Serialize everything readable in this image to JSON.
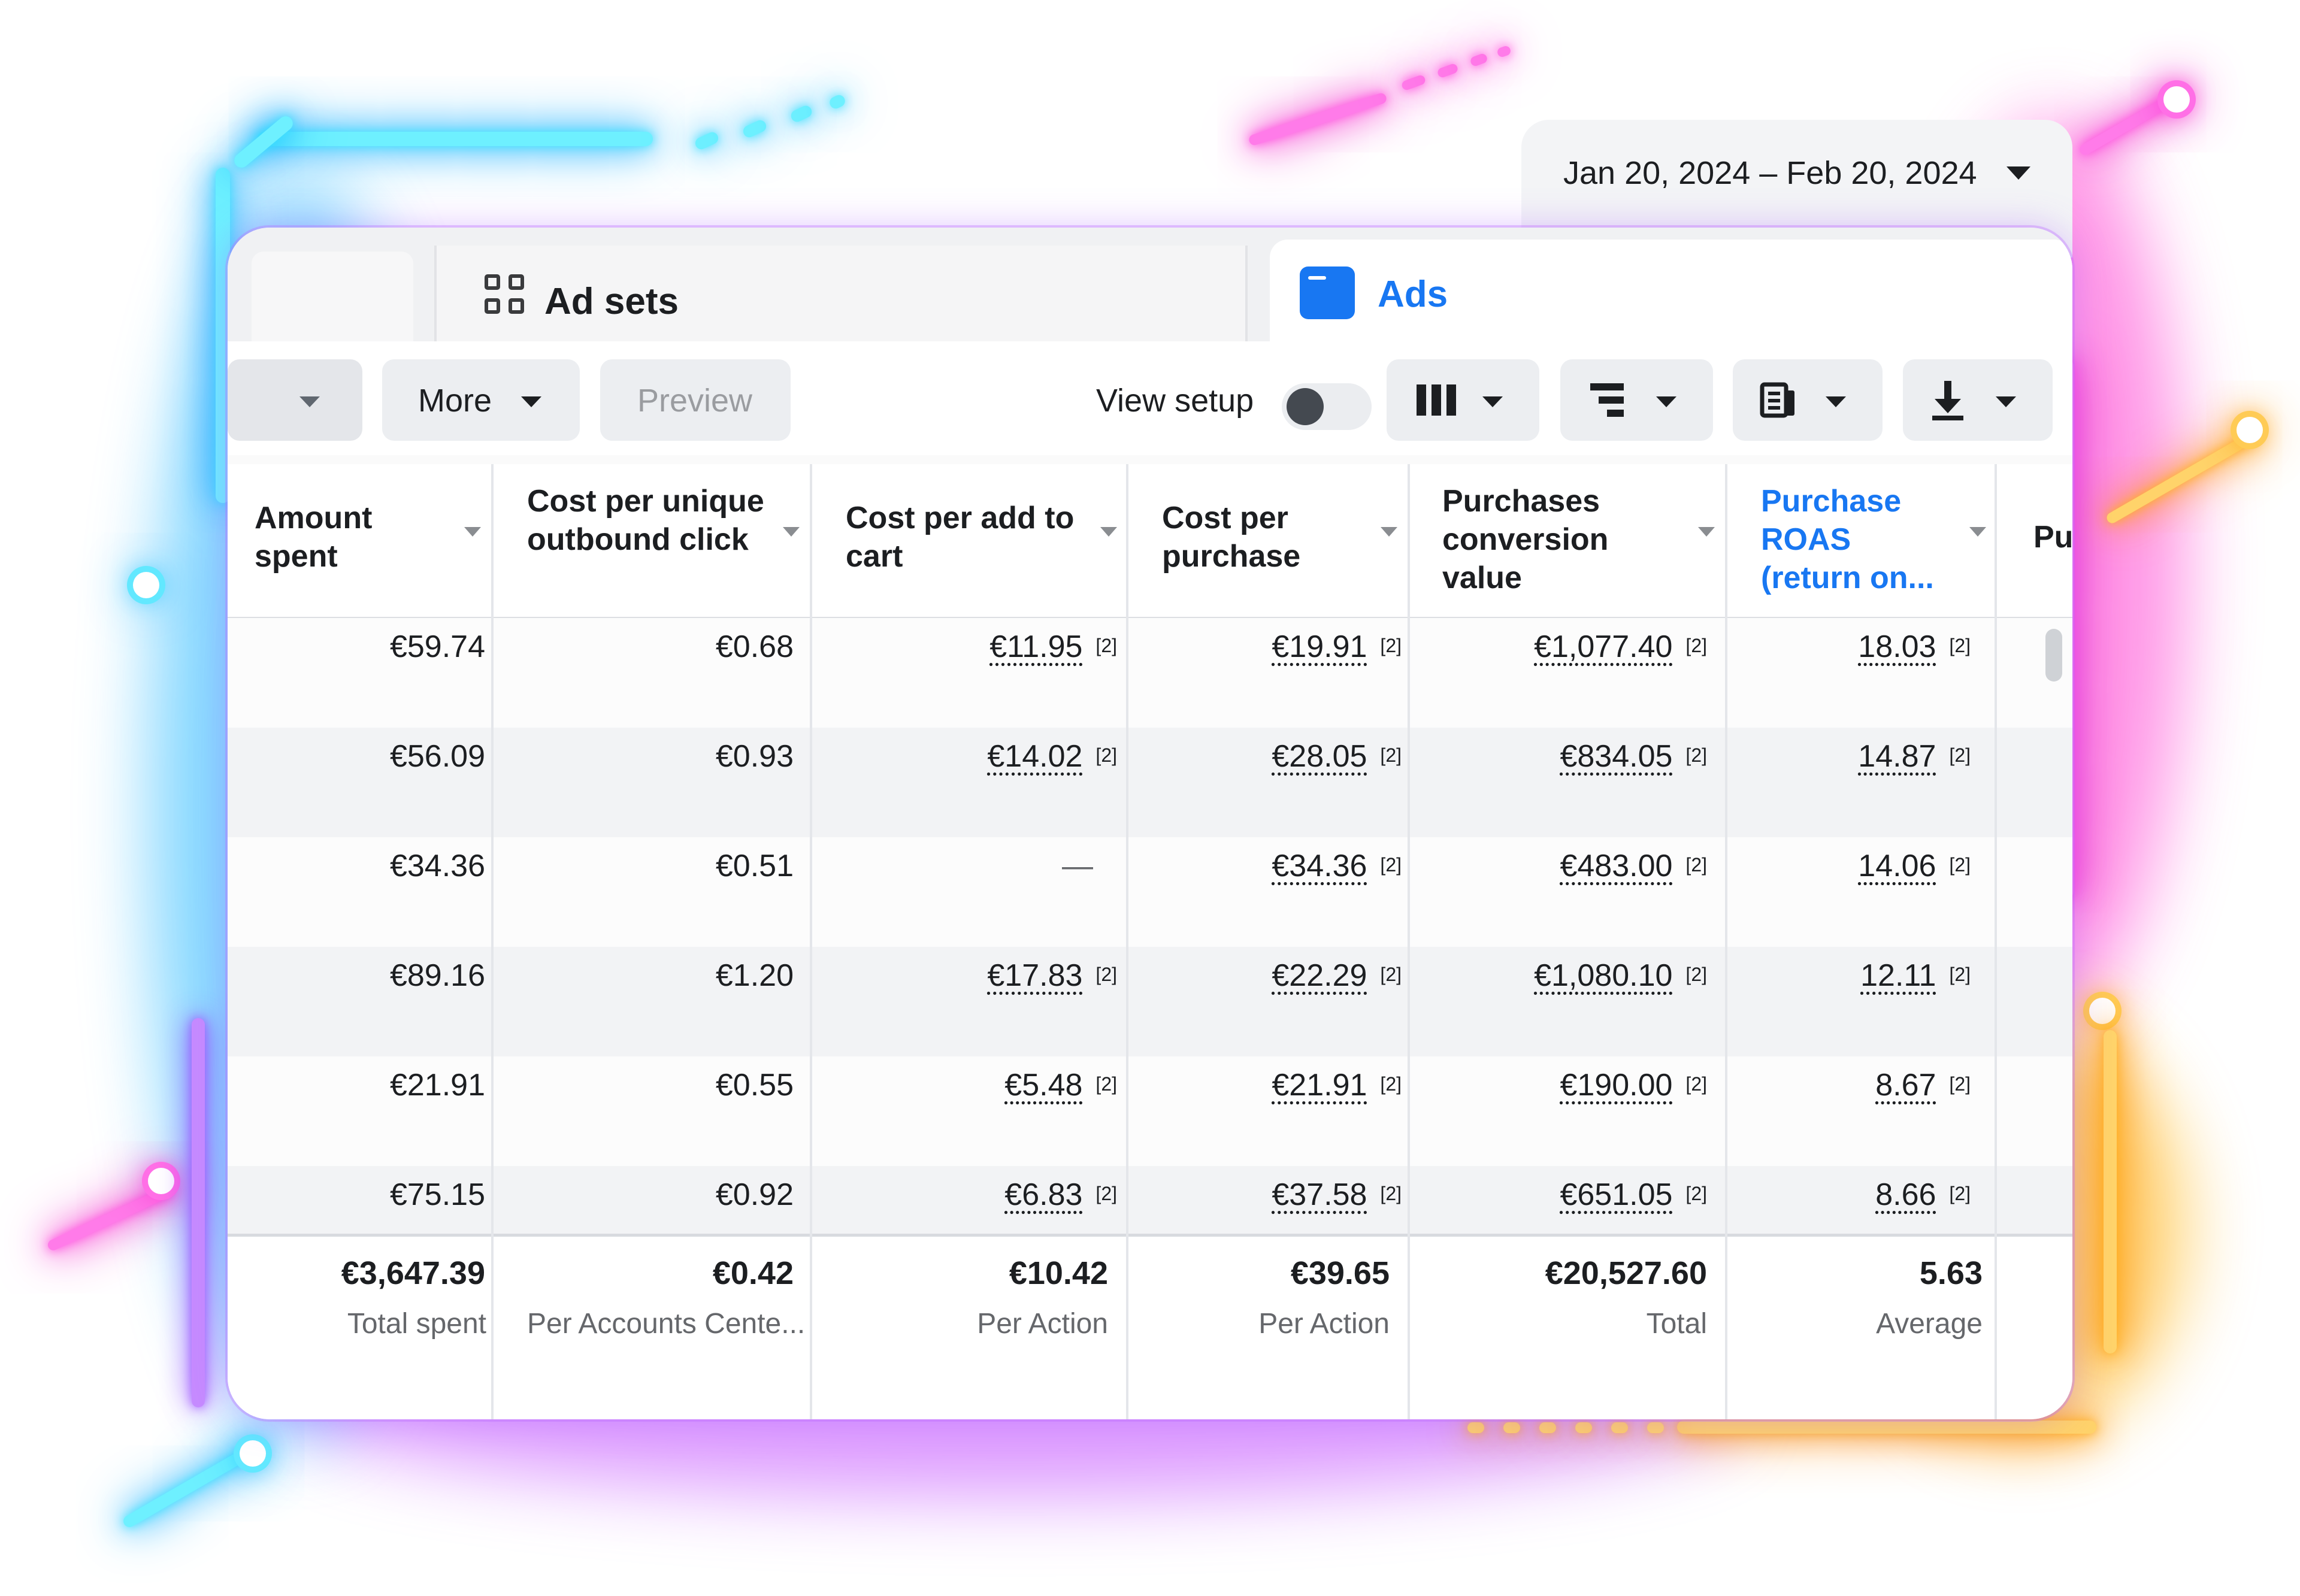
{
  "date_range": {
    "label": "Jan 20, 2024 – Feb 20, 2024"
  },
  "tabs": [
    {
      "label": "Ad sets",
      "icon": "grid-icon"
    },
    {
      "label": "Ads",
      "icon": "ad-icon",
      "active": true
    }
  ],
  "toolbar": {
    "more_label": "More",
    "preview_label": "Preview",
    "view_setup_label": "View setup",
    "view_setup_on": false,
    "icons": [
      "columns-icon",
      "breakdown-icon",
      "reports-icon",
      "export-icon"
    ]
  },
  "table": {
    "columns": [
      "Amount spent",
      "Cost per unique outbound click",
      "Cost per add to cart",
      "Cost per purchase",
      "Purchases conversion value",
      "Purchase ROAS (return on...",
      "Pu"
    ],
    "note_marker": "[2]",
    "rows": [
      [
        "€59.74",
        "€0.68",
        "€11.95",
        "€19.91",
        "€1,077.40",
        "18.03"
      ],
      [
        "€56.09",
        "€0.93",
        "€14.02",
        "€28.05",
        "€834.05",
        "14.87"
      ],
      [
        "€34.36",
        "€0.51",
        "—",
        "€34.36",
        "€483.00",
        "14.06"
      ],
      [
        "€89.16",
        "€1.20",
        "€17.83",
        "€22.29",
        "€1,080.10",
        "12.11"
      ],
      [
        "€21.91",
        "€0.55",
        "€5.48",
        "€21.91",
        "€190.00",
        "8.67"
      ],
      [
        "€75.15",
        "€0.92",
        "€6.83",
        "€37.58",
        "€651.05",
        "8.66"
      ]
    ],
    "totals": [
      {
        "value": "€3,647.39",
        "label": "Total spent"
      },
      {
        "value": "€0.42",
        "label": "Per Accounts Cente..."
      },
      {
        "value": "€10.42",
        "label": "Per Action"
      },
      {
        "value": "€39.65",
        "label": "Per Action"
      },
      {
        "value": "€20,527.60",
        "label": "Total"
      },
      {
        "value": "5.63",
        "label": "Average"
      }
    ]
  },
  "colors": {
    "accent_blue": "#1877f2",
    "neon_cyan": "#38e1ff",
    "neon_pink": "#ff2bd0",
    "neon_orange": "#ffa400"
  }
}
